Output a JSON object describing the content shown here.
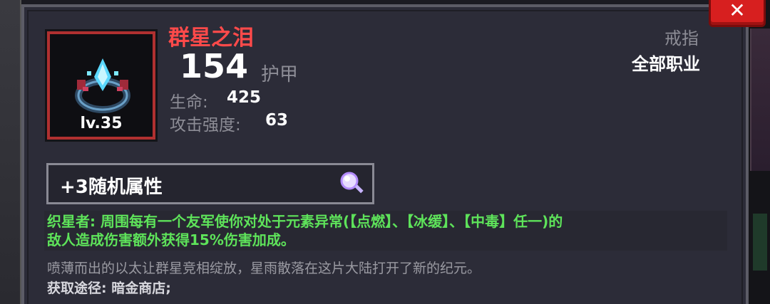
{
  "item": {
    "name": "群星之泪",
    "level": "lv.35",
    "type": "戒指",
    "class_req": "全部职业",
    "main_stat": {
      "value": "154",
      "label": "护甲"
    },
    "stats": [
      {
        "label": "生命:",
        "value": "425"
      },
      {
        "label": "攻击强度:",
        "value": "63"
      }
    ],
    "random_attr": "+3随机属性",
    "effect_line1": "织星者: 周围每有一个友军使你对处于元素异常(【点燃】、【冰缓】、【中毒】任一)的",
    "effect_line2": "敌人造成伤害额外获得15%伤害加成。",
    "flavor": "喷薄而出的以太让群星竞相绽放，星雨散落在这片大陆打开了新的纪元。",
    "source": "获取途径: 暗金商店;"
  },
  "colors": {
    "name": "#ff4a4a",
    "effect": "#5ee35a",
    "frame": "#b03030"
  },
  "icons": {
    "item": "star-ring-icon",
    "search": "magnifier-icon",
    "close": "close-icon"
  }
}
